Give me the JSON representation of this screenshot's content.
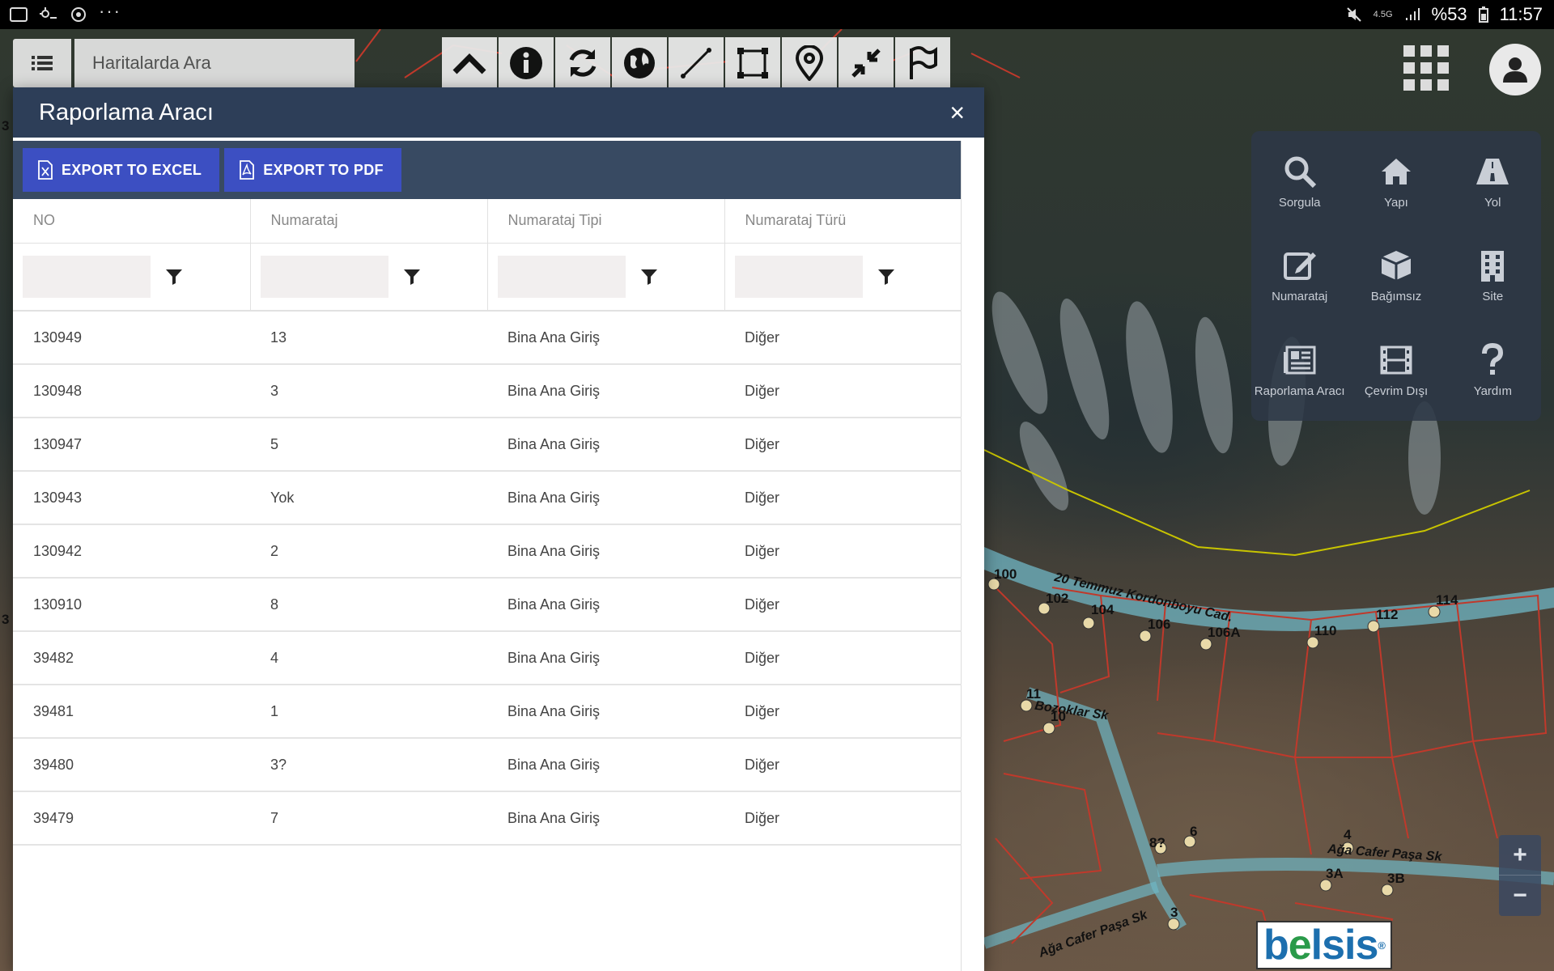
{
  "status_bar": {
    "battery": "%53",
    "time": "11:57",
    "network": "4.5G"
  },
  "search": {
    "placeholder": "Haritalarda Ara"
  },
  "toolbar": {
    "icons": [
      "chevron-up-icon",
      "info-icon",
      "refresh-icon",
      "globe-icon",
      "measure-line-icon",
      "select-rectangle-icon",
      "location-pin-icon",
      "collapse-icon",
      "flag-icon"
    ]
  },
  "dialog": {
    "title": "Raporlama Aracı",
    "close_label": "×",
    "export_excel_label": "EXPORT TO EXCEL",
    "export_pdf_label": "EXPORT TO PDF"
  },
  "table": {
    "columns": [
      "NO",
      "Numarataj",
      "Numarataj Tipi",
      "Numarataj Türü"
    ],
    "rows": [
      [
        "130949",
        "13",
        "Bina Ana Giriş",
        "Diğer"
      ],
      [
        "130948",
        "3",
        "Bina Ana Giriş",
        "Diğer"
      ],
      [
        "130947",
        "5",
        "Bina Ana Giriş",
        "Diğer"
      ],
      [
        "130943",
        "Yok",
        "Bina Ana Giriş",
        "Diğer"
      ],
      [
        "130942",
        "2",
        "Bina Ana Giriş",
        "Diğer"
      ],
      [
        "130910",
        "8",
        "Bina Ana Giriş",
        "Diğer"
      ],
      [
        "39482",
        "4",
        "Bina Ana Giriş",
        "Diğer"
      ],
      [
        "39481",
        "1",
        "Bina Ana Giriş",
        "Diğer"
      ],
      [
        "39480",
        "3?",
        "Bina Ana Giriş",
        "Diğer"
      ],
      [
        "39479",
        "7",
        "Bina Ana Giriş",
        "Diğer"
      ]
    ]
  },
  "app_panel": {
    "items": [
      {
        "label": "Sorgula",
        "icon": "search-icon"
      },
      {
        "label": "Yapı",
        "icon": "home-icon"
      },
      {
        "label": "Yol",
        "icon": "road-icon"
      },
      {
        "label": "Numarataj",
        "icon": "edit-icon"
      },
      {
        "label": "Bağımsız",
        "icon": "cube-icon"
      },
      {
        "label": "Site",
        "icon": "building-icon"
      },
      {
        "label": "Raporlama Aracı",
        "icon": "report-icon"
      },
      {
        "label": "Çevrim Dışı",
        "icon": "film-icon"
      },
      {
        "label": "Yardım",
        "icon": "help-icon"
      }
    ]
  },
  "map": {
    "street_labels": [
      "20 Temmuz Kordonboyu Cad.",
      "Bozoklar Sk",
      "Ağa Cafer Paşa Sk",
      "Ağa Cafer Paşa Sk"
    ],
    "parcel_numbers": [
      "100",
      "102",
      "104",
      "106",
      "106A",
      "110",
      "112",
      "114",
      "11",
      "10",
      "8?",
      "6",
      "4",
      "3A",
      "3B",
      "3",
      "3",
      "3"
    ]
  },
  "zoom": {
    "in_label": "+",
    "out_label": "−"
  },
  "logo": {
    "text": "belsis"
  },
  "colors": {
    "dialog_header": "#2d3e58",
    "export_bar": "#384a62",
    "export_button": "#3c4fc2",
    "app_panel": "#2d3847"
  }
}
